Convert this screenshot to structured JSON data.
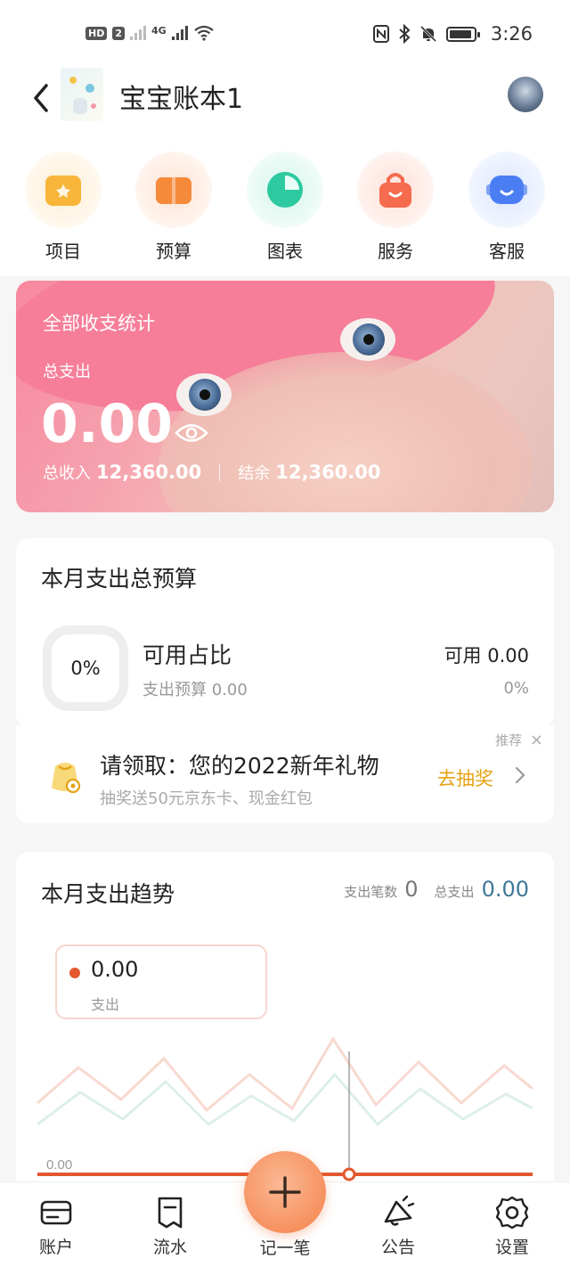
{
  "status_bar": {
    "hd_badge": "HD",
    "sim_slot": "2",
    "network": "4G",
    "time": "3:26"
  },
  "header": {
    "title": "宝宝账本1",
    "back_icon": "chevron-left-icon",
    "avatar": "user-avatar"
  },
  "quick_actions": [
    {
      "label": "项目",
      "icon": "folder-icon",
      "color": "#f7b63a"
    },
    {
      "label": "预算",
      "icon": "wallet-icon",
      "color": "#f58a3b"
    },
    {
      "label": "图表",
      "icon": "pie-chart-icon",
      "color": "#2dc9a0"
    },
    {
      "label": "服务",
      "icon": "shopping-bag-icon",
      "color": "#f56b4e"
    },
    {
      "label": "客服",
      "icon": "robot-icon",
      "color": "#4c7ef3"
    }
  ],
  "banner": {
    "title": "全部收支统计",
    "expense_label": "总支出",
    "expense_value": "0.00",
    "income_label": "总收入",
    "income_value": "12,360.00",
    "balance_label": "结余",
    "balance_value": "12,360.00"
  },
  "budget": {
    "title": "本月支出总预算",
    "percent": "0%",
    "ratio_label": "可用占比",
    "budget_line": "支出预算 0.00",
    "available_line": "可用 0.00",
    "available_percent": "0%"
  },
  "promo": {
    "tag": "推荐",
    "close": "×",
    "title": "请领取：您的2022新年礼物",
    "subtitle": "抽奖送50元京东卡、现金红包",
    "action": "去抽奖"
  },
  "trend": {
    "title": "本月支出趋势",
    "count_label": "支出笔数",
    "count_value": "0",
    "total_label": "总支出",
    "total_value": "0.00",
    "legend_value": "0.00",
    "legend_label": "支出",
    "axis_label": "0.00",
    "accent": "#e4572e"
  },
  "bottom_nav": [
    {
      "label": "账户",
      "icon": "card-icon"
    },
    {
      "label": "流水",
      "icon": "receipt-icon"
    },
    {
      "label": "记一笔",
      "icon": "plus-icon"
    },
    {
      "label": "公告",
      "icon": "megaphone-icon"
    },
    {
      "label": "设置",
      "icon": "gear-icon"
    }
  ]
}
